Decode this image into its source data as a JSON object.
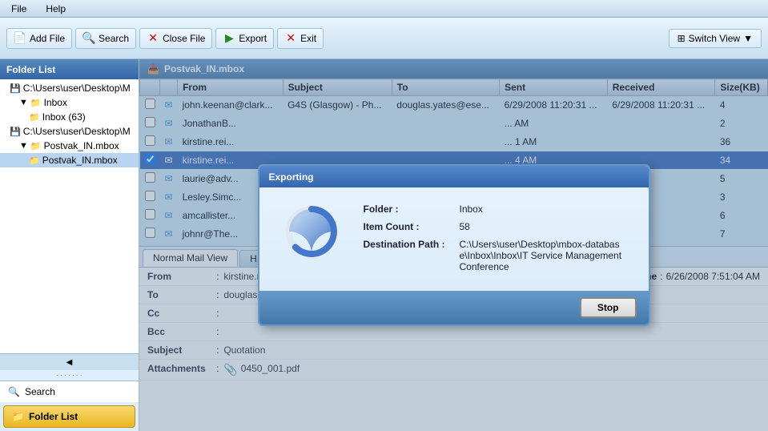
{
  "menubar": {
    "items": [
      "File",
      "Help"
    ]
  },
  "toolbar": {
    "add_file": "Add File",
    "search": "Search",
    "close_file": "Close File",
    "export": "Export",
    "exit": "Exit",
    "switch_view": "Switch View"
  },
  "sidebar": {
    "header": "Folder List",
    "tree": [
      {
        "label": "C:\\Users\\user\\Desktop\\M",
        "indent": 1,
        "icon": "hdd"
      },
      {
        "label": "Inbox",
        "indent": 2,
        "icon": "folder"
      },
      {
        "label": "Inbox (63)",
        "indent": 3,
        "icon": "folder"
      },
      {
        "label": "C:\\Users\\user\\Desktop\\M",
        "indent": 1,
        "icon": "hdd"
      },
      {
        "label": "Postvak_IN.mbox",
        "indent": 2,
        "icon": "folder"
      },
      {
        "label": "Postvak_IN.mbox",
        "indent": 3,
        "icon": "folder",
        "selected": true
      }
    ],
    "search_label": "Search",
    "folder_list_label": "Folder List"
  },
  "content": {
    "header": "Postvak_IN.mbox",
    "columns": [
      "",
      "",
      "From",
      "Subject",
      "To",
      "Sent",
      "Received",
      "Size(KB)"
    ],
    "emails": [
      {
        "from": "john.keenan@clark...",
        "subject": "G4S (Glasgow) - Ph...",
        "to": "douglas.yates@ese...",
        "sent": "6/29/2008 11:20:31 ...",
        "received": "6/29/2008 11:20:31 ...",
        "size": "4",
        "selected": false
      },
      {
        "from": "JonathanB...",
        "subject": "",
        "to": "",
        "sent": "... AM",
        "received": "",
        "size": "2",
        "selected": false
      },
      {
        "from": "kirstine.rei...",
        "subject": "",
        "to": "",
        "sent": "... 1 AM",
        "received": "",
        "size": "36",
        "selected": false
      },
      {
        "from": "kirstine.rei...",
        "subject": "",
        "to": "",
        "sent": "... 4 AM",
        "received": "",
        "size": "34",
        "selected": true
      },
      {
        "from": "laurie@adv...",
        "subject": "",
        "to": "",
        "sent": "... 3 AM",
        "received": "",
        "size": "5",
        "selected": false
      },
      {
        "from": "Lesley.Simc...",
        "subject": "",
        "to": "",
        "sent": "... 0 AM",
        "received": "",
        "size": "3",
        "selected": false
      },
      {
        "from": "amcallister...",
        "subject": "",
        "to": "",
        "sent": "... AM",
        "received": "",
        "size": "6",
        "selected": false
      },
      {
        "from": "johnr@The...",
        "subject": "",
        "to": "",
        "sent": "... AM",
        "received": "",
        "size": "7",
        "selected": false
      }
    ],
    "tabs": [
      {
        "label": "Normal Mail View",
        "active": true
      },
      {
        "label": "H...",
        "active": false
      },
      {
        "label": "...tachments",
        "active": false
      }
    ]
  },
  "preview": {
    "from_label": "From",
    "from_value": "kirstine.reid@axis.gb.com",
    "to_label": "To",
    "to_value": "douglas.yates@ese-scotland.co.uk",
    "cc_label": "Cc",
    "cc_value": "",
    "bcc_label": "Bcc",
    "bcc_value": "",
    "subject_label": "Subject",
    "subject_value": "Quotation",
    "attachments_label": "Attachments",
    "attachments_value": "0450_001.pdf",
    "date_time_label": "Date Time",
    "date_time_value": "6/26/2008 7:51:04 AM"
  },
  "dialog": {
    "title": "Exporting",
    "folder_label": "Folder :",
    "folder_value": "Inbox",
    "item_count_label": "Item Count :",
    "item_count_value": "58",
    "dest_path_label": "Destination Path :",
    "dest_path_value": "C:\\Users\\user\\Desktop\\mbox-database\\Inbox\\Inbox\\IT Service Management Conference",
    "stop_label": "Stop"
  }
}
